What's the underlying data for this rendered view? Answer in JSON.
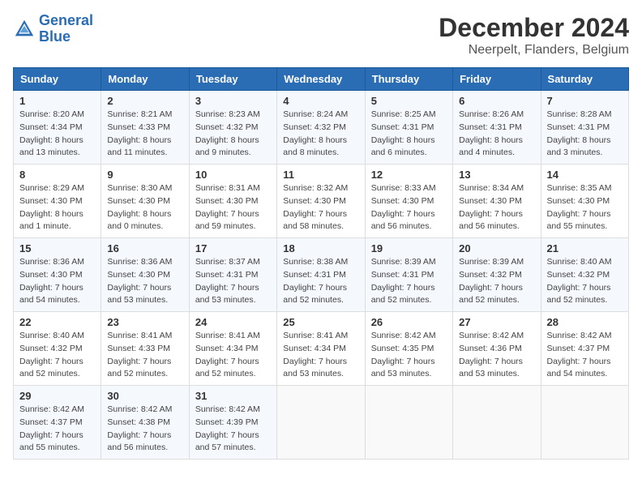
{
  "header": {
    "logo_line1": "General",
    "logo_line2": "Blue",
    "title": "December 2024",
    "subtitle": "Neerpelt, Flanders, Belgium"
  },
  "calendar": {
    "days_of_week": [
      "Sunday",
      "Monday",
      "Tuesday",
      "Wednesday",
      "Thursday",
      "Friday",
      "Saturday"
    ],
    "weeks": [
      [
        {
          "day": "1",
          "sunrise": "Sunrise: 8:20 AM",
          "sunset": "Sunset: 4:34 PM",
          "daylight": "Daylight: 8 hours and 13 minutes."
        },
        {
          "day": "2",
          "sunrise": "Sunrise: 8:21 AM",
          "sunset": "Sunset: 4:33 PM",
          "daylight": "Daylight: 8 hours and 11 minutes."
        },
        {
          "day": "3",
          "sunrise": "Sunrise: 8:23 AM",
          "sunset": "Sunset: 4:32 PM",
          "daylight": "Daylight: 8 hours and 9 minutes."
        },
        {
          "day": "4",
          "sunrise": "Sunrise: 8:24 AM",
          "sunset": "Sunset: 4:32 PM",
          "daylight": "Daylight: 8 hours and 8 minutes."
        },
        {
          "day": "5",
          "sunrise": "Sunrise: 8:25 AM",
          "sunset": "Sunset: 4:31 PM",
          "daylight": "Daylight: 8 hours and 6 minutes."
        },
        {
          "day": "6",
          "sunrise": "Sunrise: 8:26 AM",
          "sunset": "Sunset: 4:31 PM",
          "daylight": "Daylight: 8 hours and 4 minutes."
        },
        {
          "day": "7",
          "sunrise": "Sunrise: 8:28 AM",
          "sunset": "Sunset: 4:31 PM",
          "daylight": "Daylight: 8 hours and 3 minutes."
        }
      ],
      [
        {
          "day": "8",
          "sunrise": "Sunrise: 8:29 AM",
          "sunset": "Sunset: 4:30 PM",
          "daylight": "Daylight: 8 hours and 1 minute."
        },
        {
          "day": "9",
          "sunrise": "Sunrise: 8:30 AM",
          "sunset": "Sunset: 4:30 PM",
          "daylight": "Daylight: 8 hours and 0 minutes."
        },
        {
          "day": "10",
          "sunrise": "Sunrise: 8:31 AM",
          "sunset": "Sunset: 4:30 PM",
          "daylight": "Daylight: 7 hours and 59 minutes."
        },
        {
          "day": "11",
          "sunrise": "Sunrise: 8:32 AM",
          "sunset": "Sunset: 4:30 PM",
          "daylight": "Daylight: 7 hours and 58 minutes."
        },
        {
          "day": "12",
          "sunrise": "Sunrise: 8:33 AM",
          "sunset": "Sunset: 4:30 PM",
          "daylight": "Daylight: 7 hours and 56 minutes."
        },
        {
          "day": "13",
          "sunrise": "Sunrise: 8:34 AM",
          "sunset": "Sunset: 4:30 PM",
          "daylight": "Daylight: 7 hours and 56 minutes."
        },
        {
          "day": "14",
          "sunrise": "Sunrise: 8:35 AM",
          "sunset": "Sunset: 4:30 PM",
          "daylight": "Daylight: 7 hours and 55 minutes."
        }
      ],
      [
        {
          "day": "15",
          "sunrise": "Sunrise: 8:36 AM",
          "sunset": "Sunset: 4:30 PM",
          "daylight": "Daylight: 7 hours and 54 minutes."
        },
        {
          "day": "16",
          "sunrise": "Sunrise: 8:36 AM",
          "sunset": "Sunset: 4:30 PM",
          "daylight": "Daylight: 7 hours and 53 minutes."
        },
        {
          "day": "17",
          "sunrise": "Sunrise: 8:37 AM",
          "sunset": "Sunset: 4:31 PM",
          "daylight": "Daylight: 7 hours and 53 minutes."
        },
        {
          "day": "18",
          "sunrise": "Sunrise: 8:38 AM",
          "sunset": "Sunset: 4:31 PM",
          "daylight": "Daylight: 7 hours and 52 minutes."
        },
        {
          "day": "19",
          "sunrise": "Sunrise: 8:39 AM",
          "sunset": "Sunset: 4:31 PM",
          "daylight": "Daylight: 7 hours and 52 minutes."
        },
        {
          "day": "20",
          "sunrise": "Sunrise: 8:39 AM",
          "sunset": "Sunset: 4:32 PM",
          "daylight": "Daylight: 7 hours and 52 minutes."
        },
        {
          "day": "21",
          "sunrise": "Sunrise: 8:40 AM",
          "sunset": "Sunset: 4:32 PM",
          "daylight": "Daylight: 7 hours and 52 minutes."
        }
      ],
      [
        {
          "day": "22",
          "sunrise": "Sunrise: 8:40 AM",
          "sunset": "Sunset: 4:32 PM",
          "daylight": "Daylight: 7 hours and 52 minutes."
        },
        {
          "day": "23",
          "sunrise": "Sunrise: 8:41 AM",
          "sunset": "Sunset: 4:33 PM",
          "daylight": "Daylight: 7 hours and 52 minutes."
        },
        {
          "day": "24",
          "sunrise": "Sunrise: 8:41 AM",
          "sunset": "Sunset: 4:34 PM",
          "daylight": "Daylight: 7 hours and 52 minutes."
        },
        {
          "day": "25",
          "sunrise": "Sunrise: 8:41 AM",
          "sunset": "Sunset: 4:34 PM",
          "daylight": "Daylight: 7 hours and 53 minutes."
        },
        {
          "day": "26",
          "sunrise": "Sunrise: 8:42 AM",
          "sunset": "Sunset: 4:35 PM",
          "daylight": "Daylight: 7 hours and 53 minutes."
        },
        {
          "day": "27",
          "sunrise": "Sunrise: 8:42 AM",
          "sunset": "Sunset: 4:36 PM",
          "daylight": "Daylight: 7 hours and 53 minutes."
        },
        {
          "day": "28",
          "sunrise": "Sunrise: 8:42 AM",
          "sunset": "Sunset: 4:37 PM",
          "daylight": "Daylight: 7 hours and 54 minutes."
        }
      ],
      [
        {
          "day": "29",
          "sunrise": "Sunrise: 8:42 AM",
          "sunset": "Sunset: 4:37 PM",
          "daylight": "Daylight: 7 hours and 55 minutes."
        },
        {
          "day": "30",
          "sunrise": "Sunrise: 8:42 AM",
          "sunset": "Sunset: 4:38 PM",
          "daylight": "Daylight: 7 hours and 56 minutes."
        },
        {
          "day": "31",
          "sunrise": "Sunrise: 8:42 AM",
          "sunset": "Sunset: 4:39 PM",
          "daylight": "Daylight: 7 hours and 57 minutes."
        },
        null,
        null,
        null,
        null
      ]
    ]
  }
}
